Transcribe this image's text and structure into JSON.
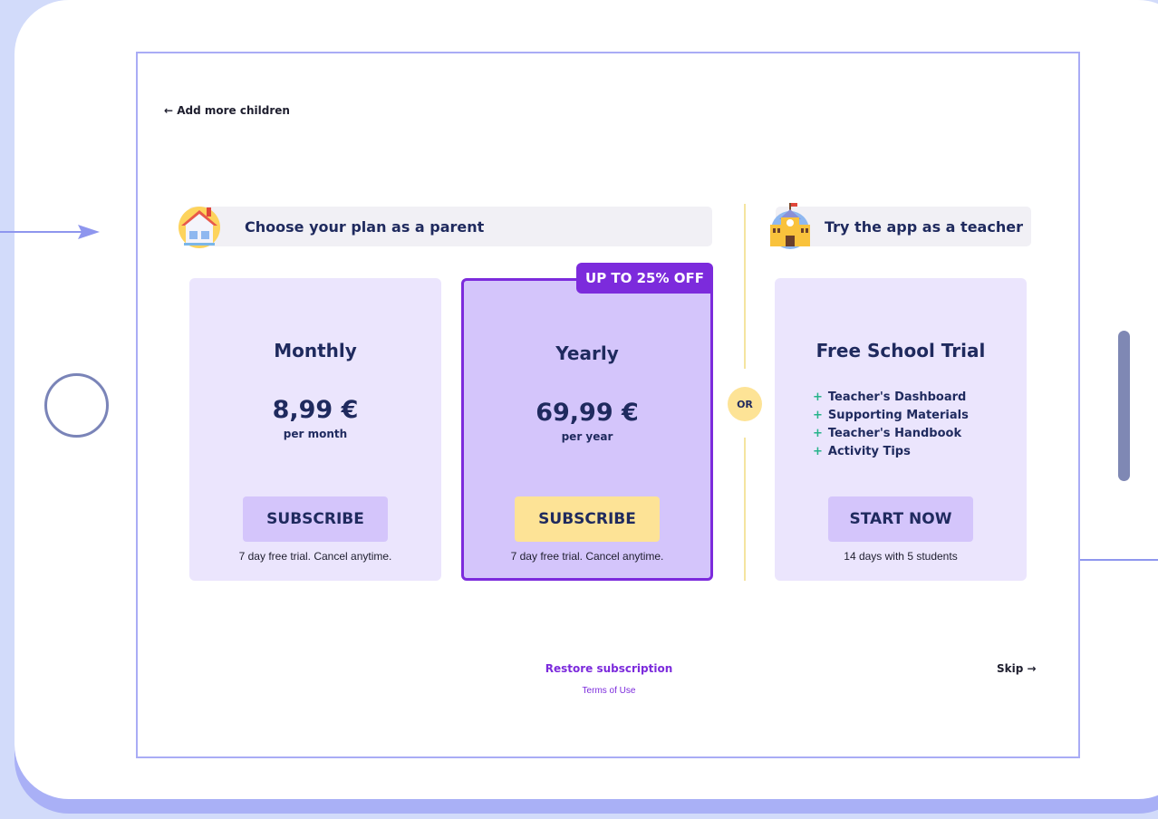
{
  "nav": {
    "back_label": "← Add more children",
    "skip_label": "Skip →"
  },
  "parent_section": {
    "title": "Choose your plan as a parent",
    "icon": "house-icon"
  },
  "teacher_section": {
    "title": "Try the app as a teacher",
    "icon": "school-icon"
  },
  "plans": {
    "monthly": {
      "name": "Monthly",
      "price": "8,99 €",
      "period": "per month",
      "button": "SUBSCRIBE",
      "note": "7 day free trial. Cancel anytime."
    },
    "yearly": {
      "badge": "UP TO 25% OFF",
      "name": "Yearly",
      "price": "69,99 €",
      "period": "per year",
      "button": "SUBSCRIBE",
      "note": "7 day free trial. Cancel anytime."
    },
    "teacher": {
      "name": "Free School Trial",
      "features": [
        "Teacher's Dashboard",
        "Supporting Materials",
        "Teacher's Handbook",
        "Activity Tips"
      ],
      "button": "START NOW",
      "note": "14 days with 5 students"
    }
  },
  "or_label": "OR",
  "footer": {
    "restore": "Restore subscription",
    "terms": "Terms of Use"
  },
  "colors": {
    "accent": "#7c2bdc",
    "navy": "#1f2a5e",
    "card": "#ebe5fd",
    "card_highlight": "#d4c5fb",
    "yellow": "#fde396",
    "green_plus": "#26b38a"
  }
}
